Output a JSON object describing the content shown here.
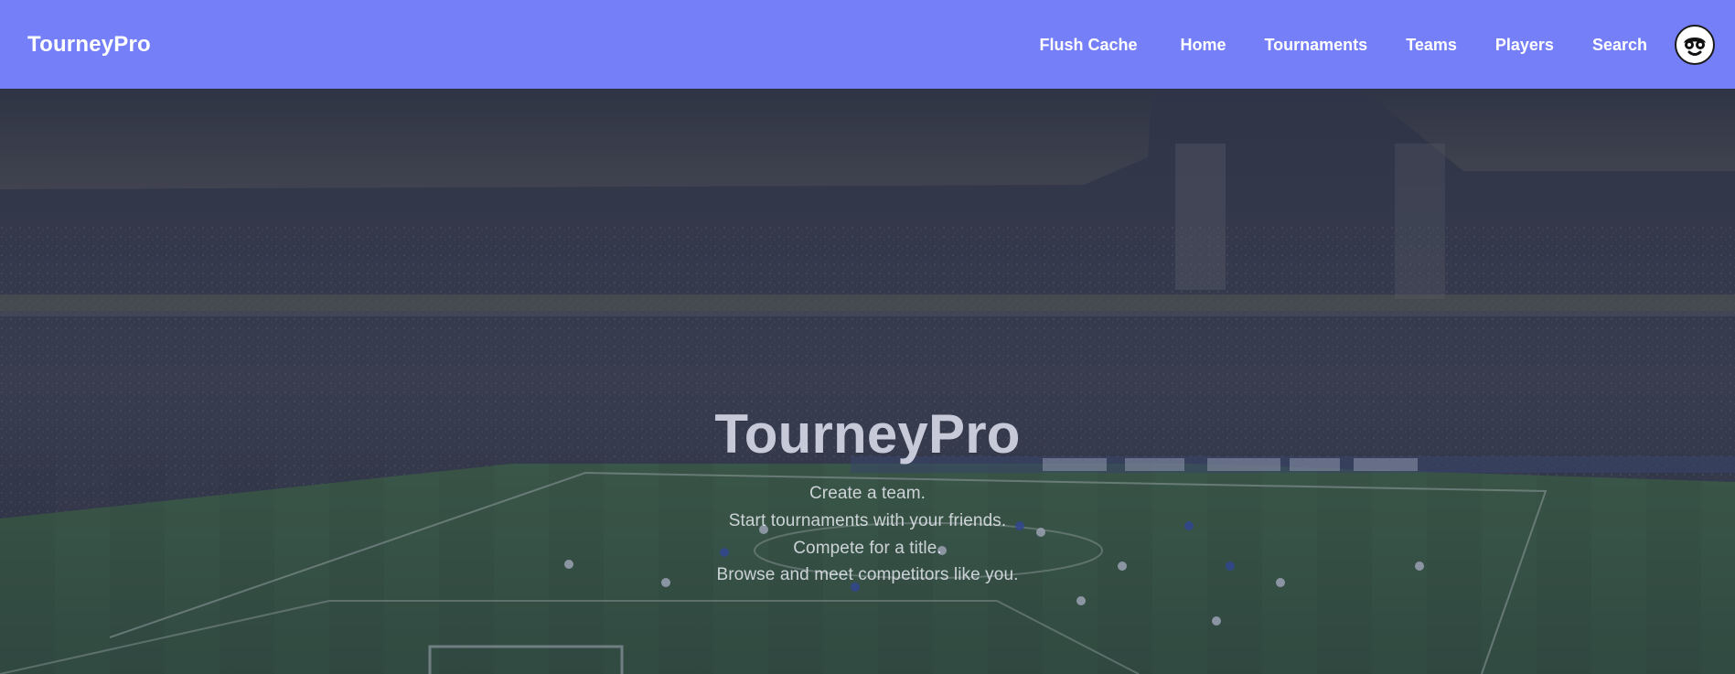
{
  "app": {
    "brand": "TourneyPro"
  },
  "nav": {
    "items": [
      {
        "label": "Flush Cache"
      },
      {
        "label": "Home"
      },
      {
        "label": "Tournaments"
      },
      {
        "label": "Teams"
      },
      {
        "label": "Players"
      },
      {
        "label": "Search"
      }
    ],
    "avatar": {
      "name": "user-avatar"
    }
  },
  "hero": {
    "title": "TourneyPro",
    "lines": [
      "Create a team.",
      "Start tournaments with your friends.",
      "Compete for a title.",
      "Browse and meet competitors like you."
    ]
  },
  "colors": {
    "nav_bg": "#7580f8",
    "nav_text": "#ffffff",
    "hero_overlay": "#363c5a"
  }
}
